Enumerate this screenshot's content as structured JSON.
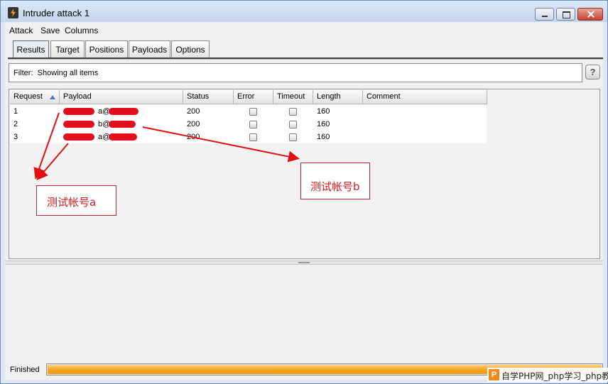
{
  "window": {
    "title": "Intruder attack 1",
    "icon": "burp-lightning-icon"
  },
  "menu": [
    "Attack",
    "Save",
    "Columns"
  ],
  "tabs": [
    {
      "label": "Results",
      "active": true
    },
    {
      "label": "Target",
      "active": false
    },
    {
      "label": "Positions",
      "active": false
    },
    {
      "label": "Payloads",
      "active": false
    },
    {
      "label": "Options",
      "active": false
    }
  ],
  "filter": {
    "label": "Filter:",
    "text": "Showing all items",
    "help_label": "?"
  },
  "table": {
    "columns": [
      "Request",
      "Payload",
      "Status",
      "Error",
      "Timeout",
      "Length",
      "Comment"
    ],
    "sorted_column": "Request",
    "rows": [
      {
        "request": "1",
        "payload_visible": "a@",
        "status": "200",
        "error": false,
        "timeout": false,
        "length": "160",
        "comment": ""
      },
      {
        "request": "2",
        "payload_visible": "b@",
        "status": "200",
        "error": false,
        "timeout": false,
        "length": "160",
        "comment": ""
      },
      {
        "request": "3",
        "payload_visible": "a@",
        "status": "200",
        "error": false,
        "timeout": false,
        "length": "160",
        "comment": ""
      }
    ]
  },
  "annotations": {
    "a": "测试帐号a",
    "b": "测试帐号b",
    "color": "#e01010"
  },
  "status": {
    "text": "Finished",
    "progress": 1.0,
    "progress_color": "#f5a523"
  },
  "watermark": {
    "logo": "P",
    "text": "自学PHP网_php学习_php教"
  }
}
